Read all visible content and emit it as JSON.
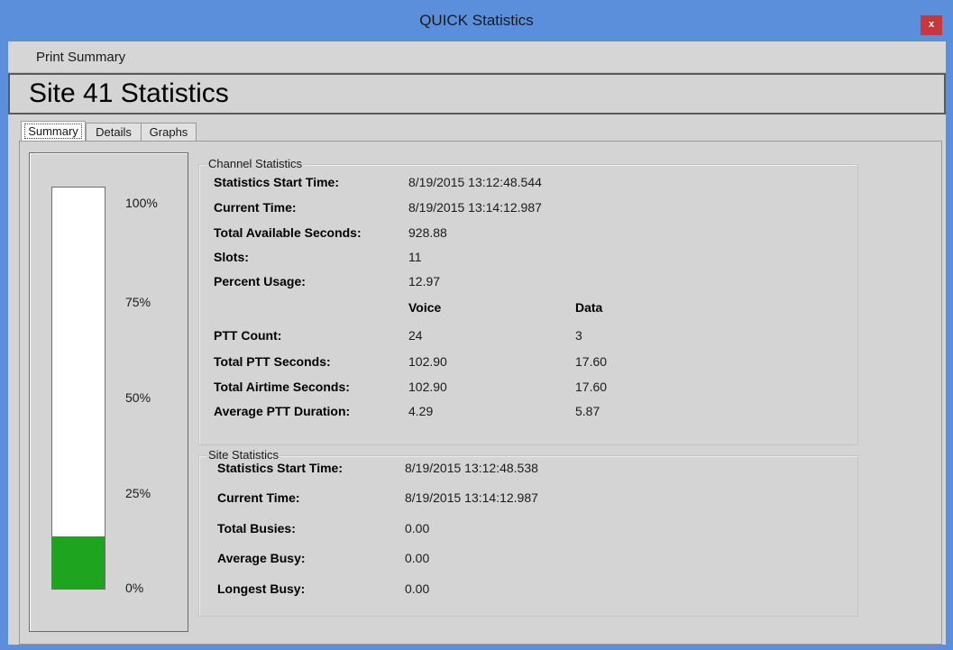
{
  "window": {
    "title": "QUICK Statistics",
    "close_glyph": "x",
    "accent_color": "#5b8fdc",
    "close_color": "#c8373c"
  },
  "menu": {
    "items": [
      {
        "label": "Print Summary"
      }
    ]
  },
  "site_title": "Site 41 Statistics",
  "tabs": [
    {
      "label": "Summary",
      "selected": true
    },
    {
      "label": "Details",
      "selected": false
    },
    {
      "label": "Graphs",
      "selected": false
    }
  ],
  "usage_meter": {
    "scale_labels": [
      "100%",
      "75%",
      "50%",
      "25%",
      "0%"
    ],
    "fill_percent": 12.97,
    "fill_color": "#1ea41e"
  },
  "channel_statistics": {
    "title": "Channel Statistics",
    "rows": [
      {
        "label": "Statistics Start Time:",
        "value": "8/19/2015 13:12:48.544"
      },
      {
        "label": "Current Time:",
        "value": "8/19/2015 13:14:12.987"
      },
      {
        "label": "Total Available Seconds:",
        "value": "928.88"
      },
      {
        "label": "Slots:",
        "value": "11"
      },
      {
        "label": "Percent Usage:",
        "value": "12.97"
      }
    ],
    "columns": {
      "voice": "Voice",
      "data": "Data"
    },
    "split_rows": [
      {
        "label": "PTT Count:",
        "voice": "24",
        "data": "3"
      },
      {
        "label": "Total PTT Seconds:",
        "voice": "102.90",
        "data": "17.60"
      },
      {
        "label": "Total Airtime Seconds:",
        "voice": "102.90",
        "data": "17.60"
      },
      {
        "label": "Average PTT Duration:",
        "voice": "4.29",
        "data": "5.87"
      }
    ]
  },
  "site_statistics": {
    "title": "Site Statistics",
    "rows": [
      {
        "label": "Statistics Start Time:",
        "value": "8/19/2015 13:12:48.538"
      },
      {
        "label": "Current Time:",
        "value": "8/19/2015 13:14:12.987"
      },
      {
        "label": "Total Busies:",
        "value": "0.00"
      },
      {
        "label": "Average Busy:",
        "value": "0.00"
      },
      {
        "label": "Longest Busy:",
        "value": "0.00"
      }
    ]
  }
}
